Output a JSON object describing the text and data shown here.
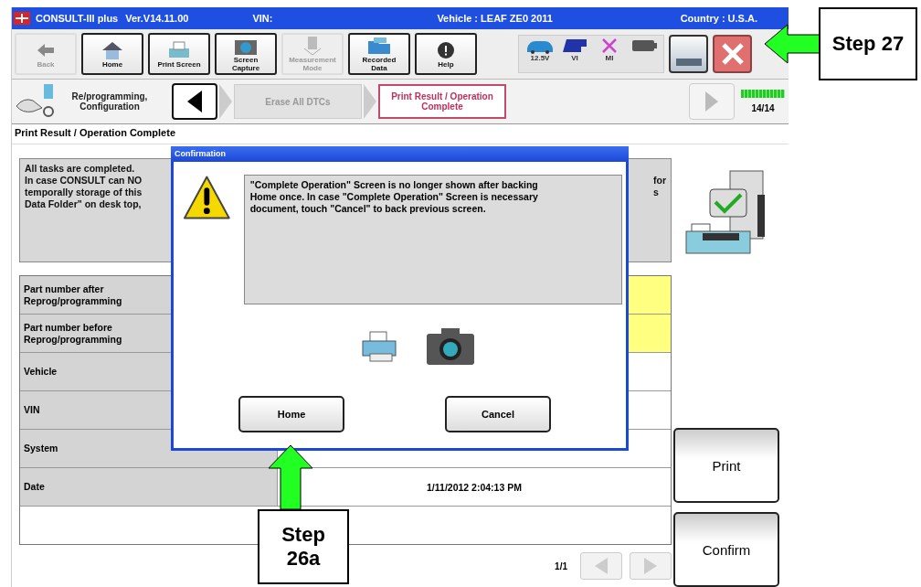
{
  "window": {
    "app": "CONSULT-III plus",
    "version": "Ver.V14.11.00",
    "vin": "VIN:",
    "vehicle": "Vehicle : LEAF ZE0 2011",
    "country": "Country : U.S.A."
  },
  "toolbar": [
    {
      "kind": "back",
      "label": "Back",
      "disabled": true
    },
    {
      "kind": "home",
      "label": "Home",
      "disabled": false
    },
    {
      "kind": "print",
      "label": "Print Screen",
      "disabled": false
    },
    {
      "kind": "camera",
      "label": "Screen Capture",
      "disabled": false
    },
    {
      "kind": "meter",
      "label": "Measurement Mode",
      "disabled": true
    },
    {
      "kind": "data",
      "label": "Recorded Data",
      "disabled": false
    },
    {
      "kind": "help",
      "label": "Help",
      "disabled": false
    }
  ],
  "status": [
    {
      "kind": "car",
      "label": "12.5V"
    },
    {
      "kind": "vi",
      "label": "VI"
    },
    {
      "kind": "mi",
      "label": "MI"
    },
    {
      "kind": "battery"
    }
  ],
  "breadcrumb": {
    "mode": "Re/programming, Configuration",
    "steps": [
      {
        "label": "Erase All DTCs",
        "selected": false
      },
      {
        "label": "Print Result / Operation Complete",
        "selected": true
      }
    ],
    "progress": "14/14",
    "level": 1
  },
  "section_title": "Print Result / Operation Complete",
  "message": {
    "left_lines": [
      "All tasks are completed.",
      "In case CONSULT can NO",
      "temporally storage of this",
      "Data Folder\" on desk top,"
    ],
    "right_lines": [
      "for",
      "s"
    ]
  },
  "table": {
    "rows": [
      {
        "label": "Part number after Reprog/programming",
        "highlight": true
      },
      {
        "label": "Part number before Reprog/programming",
        "highlight": true
      },
      {
        "label": "Vehicle",
        "highlight": false
      },
      {
        "label": "VIN",
        "highlight": false
      },
      {
        "label": "System",
        "highlight": false
      },
      {
        "label": "Date",
        "value": "1/11/2012 2:04:13 PM",
        "highlight": false
      }
    ]
  },
  "pager": "1/1",
  "side_buttons": [
    "Print",
    "Confirm"
  ],
  "dialog": {
    "title": "Confirmation",
    "text": "\"Complete Operation\" Screen is no longer shown after backing Home once. In case \"Complete Operation\" Screen is necessary document, touch \"Cancel\" to back previous screen.",
    "buttons": [
      "Home",
      "Cancel"
    ]
  },
  "callouts": [
    {
      "kind": "left",
      "text": "Step 27"
    },
    {
      "kind": "up",
      "text": "Step 26a"
    }
  ]
}
